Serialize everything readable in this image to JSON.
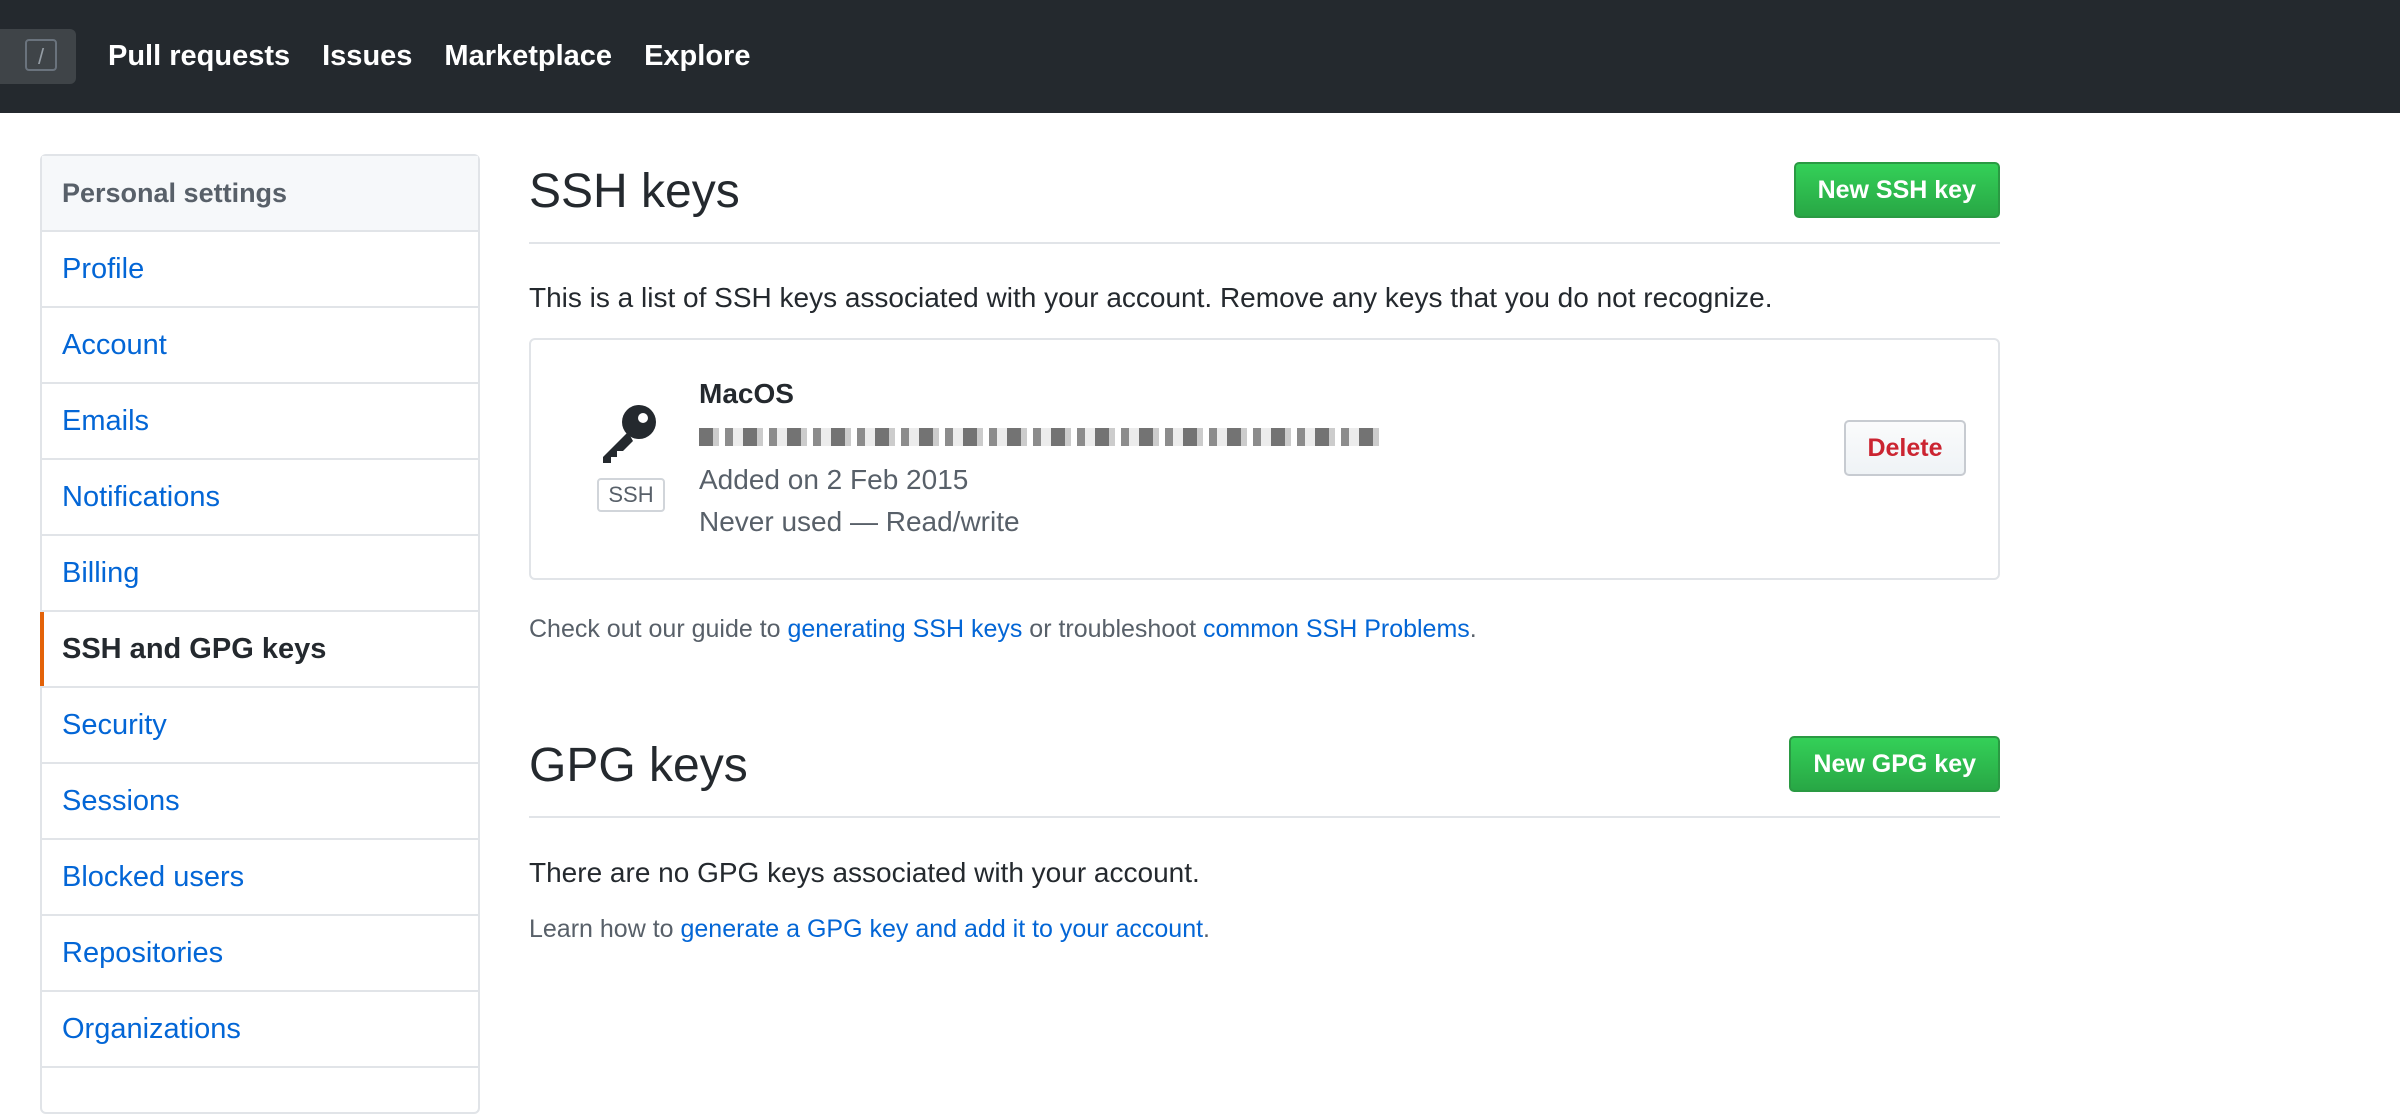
{
  "header": {
    "slash_key": "/",
    "nav": [
      "Pull requests",
      "Issues",
      "Marketplace",
      "Explore"
    ]
  },
  "sidebar": {
    "heading": "Personal settings",
    "items": [
      {
        "label": "Profile"
      },
      {
        "label": "Account"
      },
      {
        "label": "Emails"
      },
      {
        "label": "Notifications"
      },
      {
        "label": "Billing"
      },
      {
        "label": "SSH and GPG keys",
        "selected": true
      },
      {
        "label": "Security"
      },
      {
        "label": "Sessions"
      },
      {
        "label": "Blocked users"
      },
      {
        "label": "Repositories"
      },
      {
        "label": "Organizations"
      }
    ]
  },
  "ssh": {
    "title": "SSH keys",
    "new_button": "New SSH key",
    "description": "This is a list of SSH keys associated with your account. Remove any keys that you do not recognize.",
    "key": {
      "badge": "SSH",
      "name": "MacOS",
      "added": "Added on 2 Feb 2015",
      "usage": "Never used — Read/write",
      "delete_label": "Delete",
      "icon": "key-icon"
    },
    "help": {
      "prefix": "Check out our guide to ",
      "link1": "generating SSH keys",
      "middle": " or troubleshoot ",
      "link2": "common SSH Problems",
      "suffix": "."
    }
  },
  "gpg": {
    "title": "GPG keys",
    "new_button": "New GPG key",
    "description": "There are no GPG keys associated with your account.",
    "help": {
      "prefix": "Learn how to ",
      "link": "generate a GPG key and add it to your account",
      "suffix": "."
    }
  },
  "colors": {
    "header_bg": "#24292e",
    "link": "#0366d6",
    "green_button": "#28a745",
    "danger": "#cb2431",
    "selected_marker": "#e36209"
  }
}
